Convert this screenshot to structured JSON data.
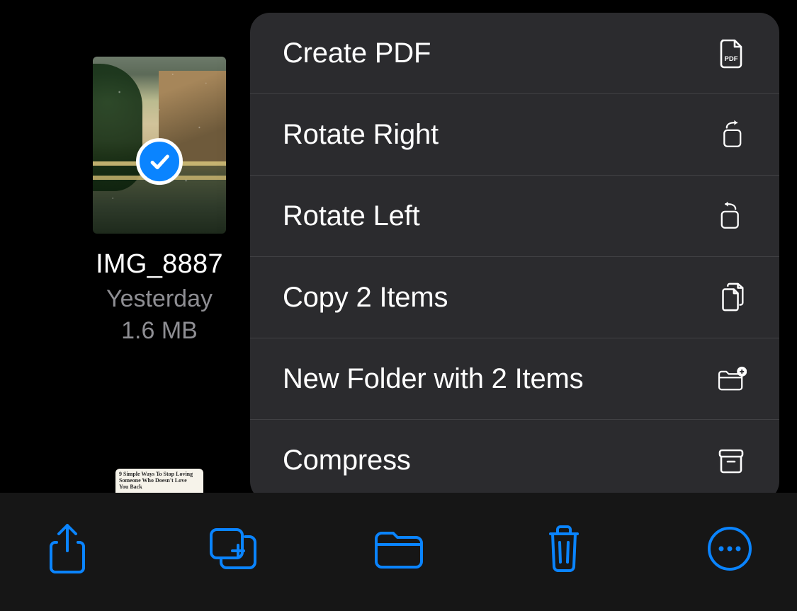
{
  "file": {
    "name": "IMG_8887",
    "date": "Yesterday",
    "size": "1.6 MB"
  },
  "peek_tile": {
    "line1": "9 Simple Ways To Stop Loving",
    "line2": "Someone Who Doesn't Love",
    "line3": "You Back"
  },
  "menu": {
    "items": [
      {
        "label": "Create PDF",
        "icon": "pdf-file-icon"
      },
      {
        "label": "Rotate Right",
        "icon": "rotate-right-icon"
      },
      {
        "label": "Rotate Left",
        "icon": "rotate-left-icon"
      },
      {
        "label": "Copy 2 Items",
        "icon": "copy-icon"
      },
      {
        "label": "New Folder with 2 Items",
        "icon": "new-folder-icon"
      },
      {
        "label": "Compress",
        "icon": "archive-icon"
      }
    ]
  },
  "toolbar": {
    "share": "Share",
    "duplicate": "Duplicate",
    "move": "Move",
    "delete": "Delete",
    "more": "More"
  },
  "colors": {
    "accent": "#0a84ff",
    "menu_bg": "#2b2b2e",
    "separator": "#414144",
    "secondary_text": "#8e8e93"
  }
}
